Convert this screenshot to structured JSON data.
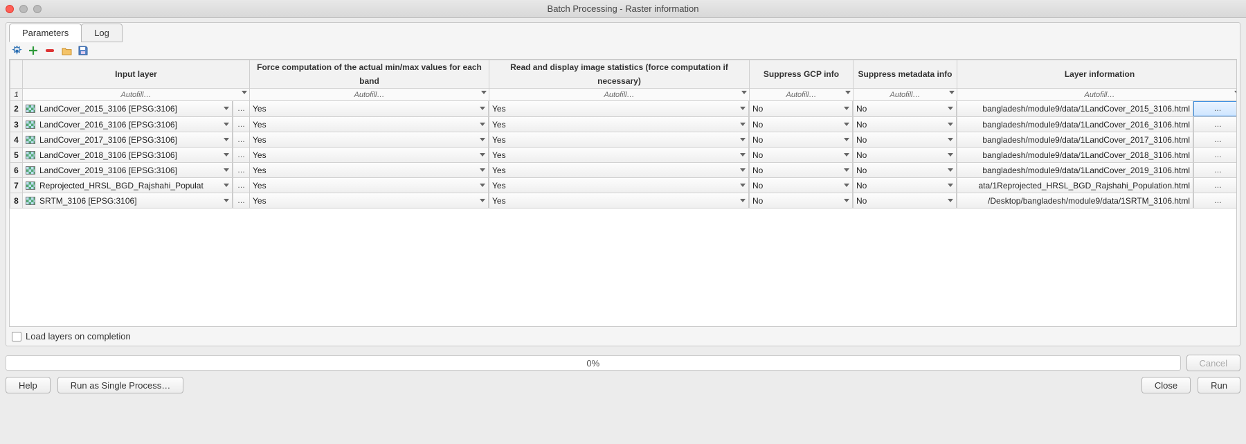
{
  "window": {
    "title": "Batch Processing - Raster information"
  },
  "tabs": {
    "parameters": "Parameters",
    "log": "Log"
  },
  "headers": {
    "input": "Input layer",
    "force": "Force computation of the actual min/max values for each band",
    "read": "Read and display image statistics (force computation if necessary)",
    "gcp": "Suppress GCP info",
    "meta": "Suppress metadata info",
    "layerinfo": "Layer information"
  },
  "autofill": "Autofill…",
  "ellipsis": "…",
  "rows": [
    {
      "n": "2",
      "input": "LandCover_2015_3106 [EPSG:3106]",
      "force": "Yes",
      "read": "Yes",
      "gcp": "No",
      "meta": "No",
      "layer": "bangladesh/module9/data/1LandCover_2015_3106.html"
    },
    {
      "n": "3",
      "input": "LandCover_2016_3106 [EPSG:3106]",
      "force": "Yes",
      "read": "Yes",
      "gcp": "No",
      "meta": "No",
      "layer": "bangladesh/module9/data/1LandCover_2016_3106.html"
    },
    {
      "n": "4",
      "input": "LandCover_2017_3106 [EPSG:3106]",
      "force": "Yes",
      "read": "Yes",
      "gcp": "No",
      "meta": "No",
      "layer": "bangladesh/module9/data/1LandCover_2017_3106.html"
    },
    {
      "n": "5",
      "input": "LandCover_2018_3106 [EPSG:3106]",
      "force": "Yes",
      "read": "Yes",
      "gcp": "No",
      "meta": "No",
      "layer": "bangladesh/module9/data/1LandCover_2018_3106.html"
    },
    {
      "n": "6",
      "input": "LandCover_2019_3106 [EPSG:3106]",
      "force": "Yes",
      "read": "Yes",
      "gcp": "No",
      "meta": "No",
      "layer": "bangladesh/module9/data/1LandCover_2019_3106.html"
    },
    {
      "n": "7",
      "input": "Reprojected_HRSL_BGD_Rajshahi_Populat",
      "force": "Yes",
      "read": "Yes",
      "gcp": "No",
      "meta": "No",
      "layer": "ata/1Reprojected_HRSL_BGD_Rajshahi_Population.html"
    },
    {
      "n": "8",
      "input": "SRTM_3106 [EPSG:3106]",
      "force": "Yes",
      "read": "Yes",
      "gcp": "No",
      "meta": "No",
      "layer": "/Desktop/bangladesh/module9/data/1SRTM_3106.html"
    }
  ],
  "checkbox": {
    "label": "Load layers on completion"
  },
  "progress": {
    "text": "0%"
  },
  "buttons": {
    "cancel": "Cancel",
    "help": "Help",
    "runSingle": "Run as Single Process…",
    "close": "Close",
    "run": "Run"
  }
}
